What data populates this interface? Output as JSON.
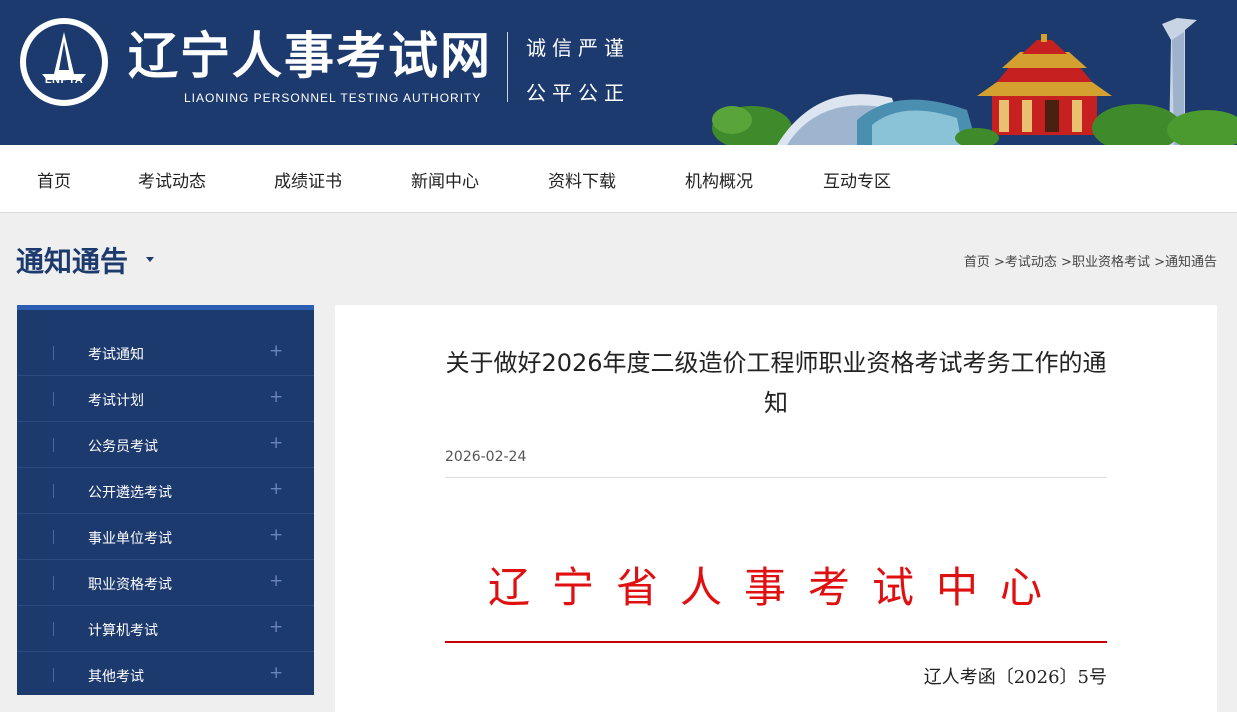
{
  "header": {
    "logo_text": "LNPTA",
    "site_title": "辽宁人事考试网",
    "site_subtitle": "LIAONING PERSONNEL TESTING AUTHORITY",
    "slogan_line1": "诚信严谨",
    "slogan_line2": "公平公正"
  },
  "nav": {
    "items": [
      {
        "label": "首页"
      },
      {
        "label": "考试动态"
      },
      {
        "label": "成绩证书"
      },
      {
        "label": "新闻中心"
      },
      {
        "label": "资料下载"
      },
      {
        "label": "机构概况"
      },
      {
        "label": "互动专区"
      }
    ]
  },
  "page": {
    "section_title": "通知通告",
    "breadcrumb": [
      "首页",
      ">考试动态",
      ">职业资格考试",
      ">通知通告"
    ]
  },
  "sidebar": {
    "items": [
      {
        "label": "考试通知"
      },
      {
        "label": "考试计划"
      },
      {
        "label": "公务员考试"
      },
      {
        "label": "公开遴选考试"
      },
      {
        "label": "事业单位考试"
      },
      {
        "label": "职业资格考试"
      },
      {
        "label": "计算机考试"
      },
      {
        "label": "其他考试"
      }
    ],
    "expand_symbol": "+"
  },
  "article": {
    "title": "关于做好2026年度二级造价工程师职业资格考试考务工作的通知",
    "date": "2026-02-24",
    "issuer": "辽宁省人事考试中心",
    "doc_number": "辽人考函〔2026〕5号"
  },
  "colors": {
    "header_bg": "#1d3a6f",
    "sidebar_accent": "#2c5fb2",
    "issuer_red": "#e01010"
  }
}
